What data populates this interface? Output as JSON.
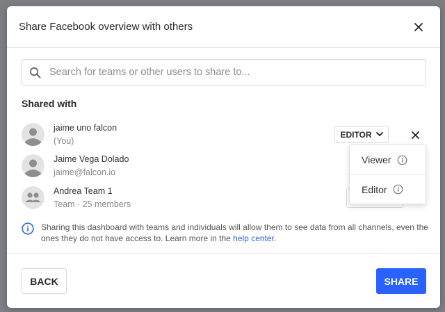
{
  "dialog": {
    "title": "Share Facebook overview with others"
  },
  "search": {
    "placeholder": "Search for teams or other users to share to..."
  },
  "shared_with": {
    "heading": "Shared with",
    "users": [
      {
        "name": "jaime uno falcon",
        "subtitle": "(You)",
        "avatar": "person-icon"
      },
      {
        "name": "Jaime Vega Dolado",
        "subtitle": "jaime@falcon.io",
        "avatar": "person-icon"
      },
      {
        "name": "Andrea Team 1",
        "subtitle": "Team · 25 members",
        "avatar": "team-icon"
      }
    ],
    "role_selected": "EDITOR"
  },
  "role_dropdown": {
    "options": [
      "Viewer",
      "Editor"
    ]
  },
  "info": {
    "text": "Sharing this dashboard with teams and individuals will allow them to see data from all channels, even the ones they do not have access to. Learn more in the ",
    "link_text": "help center",
    "suffix": "."
  },
  "footer": {
    "back_label": "BACK",
    "share_label": "SHARE"
  },
  "colors": {
    "primary": "#2962ff",
    "link": "#2a63e6",
    "avatar_bg": "#e3e3e3"
  }
}
